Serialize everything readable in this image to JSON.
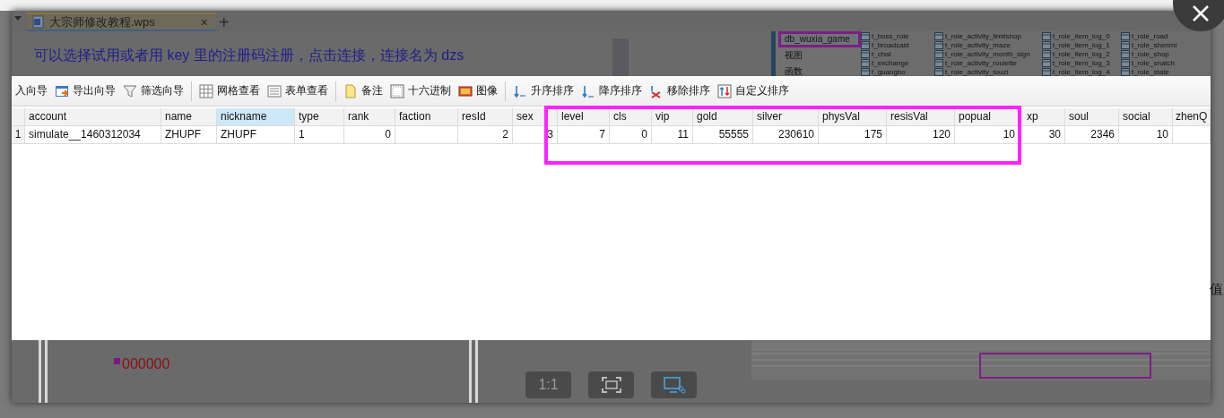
{
  "document_tab": {
    "title": "大宗师修改教程.wps",
    "close": "×",
    "new_tab": "+"
  },
  "document": {
    "sentence": "可以选择试用或者用 key 里的注册码注册，点击连接，连接名为 dzs",
    "red_text": "000000"
  },
  "db_panel": {
    "tree": [
      {
        "label": "db_wuxia_game",
        "selected": true
      },
      {
        "label": "视图",
        "selected": false
      },
      {
        "label": "函数",
        "selected": false
      }
    ],
    "tables": [
      [
        "t_boss_role",
        "t_broadcast",
        "t_chat",
        "t_exchange",
        "t_guangbo"
      ],
      [
        "t_role_activity_limitshop",
        "t_role_activity_maze",
        "t_role_activity_month_sign",
        "t_role_activity_roulette",
        "t_role_activity_touzi"
      ],
      [
        "t_role_item_log_0",
        "t_role_item_log_1",
        "t_role_item_log_2",
        "t_role_item_log_3",
        "t_role_item_log_4"
      ],
      [
        "t_role_road",
        "t_role_shenmi",
        "t_role_shop",
        "t_role_snatch",
        "t_role_state"
      ]
    ]
  },
  "toolbar": [
    {
      "label": "入向导"
    },
    {
      "label": "导出向导"
    },
    {
      "label": "筛选向导"
    },
    {
      "label": "网格查看",
      "group_start": true
    },
    {
      "label": "表单查看"
    },
    {
      "label": "备注",
      "group_start": true
    },
    {
      "label": "十六进制"
    },
    {
      "label": "图像"
    },
    {
      "label": "升序排序",
      "group_start": true
    },
    {
      "label": "降序排序"
    },
    {
      "label": "移除排序"
    },
    {
      "label": "自定义排序"
    }
  ],
  "table": {
    "columns": [
      {
        "label": "account",
        "kind": "text",
        "selected": false
      },
      {
        "label": "name",
        "kind": "text",
        "selected": false
      },
      {
        "label": "nickname",
        "kind": "text",
        "selected": true
      },
      {
        "label": "type",
        "kind": "text",
        "selected": false
      },
      {
        "label": "rank",
        "kind": "number",
        "selected": false
      },
      {
        "label": "faction",
        "kind": "text",
        "selected": false
      },
      {
        "label": "resId",
        "kind": "number",
        "selected": false
      },
      {
        "label": "sex",
        "kind": "number",
        "selected": false
      },
      {
        "label": "level",
        "kind": "number",
        "selected": false
      },
      {
        "label": "cls",
        "kind": "number",
        "selected": false
      },
      {
        "label": "vip",
        "kind": "number",
        "selected": false
      },
      {
        "label": "gold",
        "kind": "number",
        "selected": false
      },
      {
        "label": "silver",
        "kind": "number",
        "selected": false
      },
      {
        "label": "physVal",
        "kind": "number",
        "selected": false
      },
      {
        "label": "resisVal",
        "kind": "number",
        "selected": false
      },
      {
        "label": "popual",
        "kind": "number",
        "selected": false
      },
      {
        "label": "xp",
        "kind": "number",
        "selected": false
      },
      {
        "label": "soul",
        "kind": "number",
        "selected": false
      },
      {
        "label": "social",
        "kind": "number",
        "selected": false
      },
      {
        "label": "zhenQ",
        "kind": "number",
        "selected": false
      }
    ],
    "rows": [
      {
        "number": "1",
        "cells": [
          "simulate__1460312034",
          "ZHUPF",
          "ZHUPF",
          "1",
          "0",
          null,
          "2",
          "3",
          "7",
          "0",
          "11",
          "55555",
          "230610",
          "175",
          "120",
          "10",
          "30",
          "2346",
          "10",
          null
        ]
      }
    ]
  },
  "side_text": "值",
  "viewer_controls": {
    "actual_size": "1:1"
  }
}
